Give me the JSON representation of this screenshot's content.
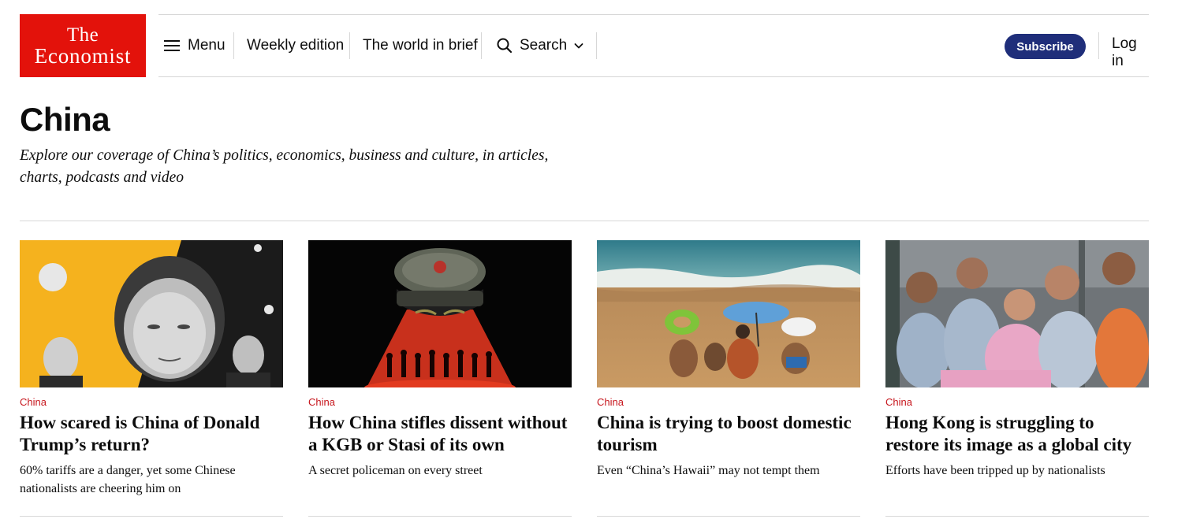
{
  "logo": {
    "line1": "The",
    "line2": "Economist"
  },
  "nav": {
    "menu": "Menu",
    "weekly": "Weekly edition",
    "brief": "The world in brief",
    "search": "Search",
    "subscribe": "Subscribe",
    "login": "Log in"
  },
  "page": {
    "title": "China",
    "description": "Explore our coverage of China’s politics, economics, business and culture, in articles, charts, podcasts and video"
  },
  "articles": [
    {
      "section": "China",
      "headline": "How scared is China of Donald Trump’s return?",
      "subhead": "60% tariffs are a danger, yet some Chinese nationalists are cheering him on"
    },
    {
      "section": "China",
      "headline": "How China stifles dissent without a KGB or Stasi of its own",
      "subhead": "A secret policeman on every street"
    },
    {
      "section": "China",
      "headline": "China is trying to boost domestic tourism",
      "subhead": "Even “China’s Hawaii” may not tempt them"
    },
    {
      "section": "China",
      "headline": "Hong Kong is struggling to restore its image as a global city",
      "subhead": "Efforts have been tripped up by nationalists"
    }
  ],
  "colors": {
    "brand_red": "#e3120b",
    "section_red": "#c7171e",
    "subscribe_navy": "#1f2e7a"
  },
  "icons": {
    "menu": "hamburger-icon",
    "search": "search-icon",
    "dropdown": "chevron-down-icon"
  }
}
